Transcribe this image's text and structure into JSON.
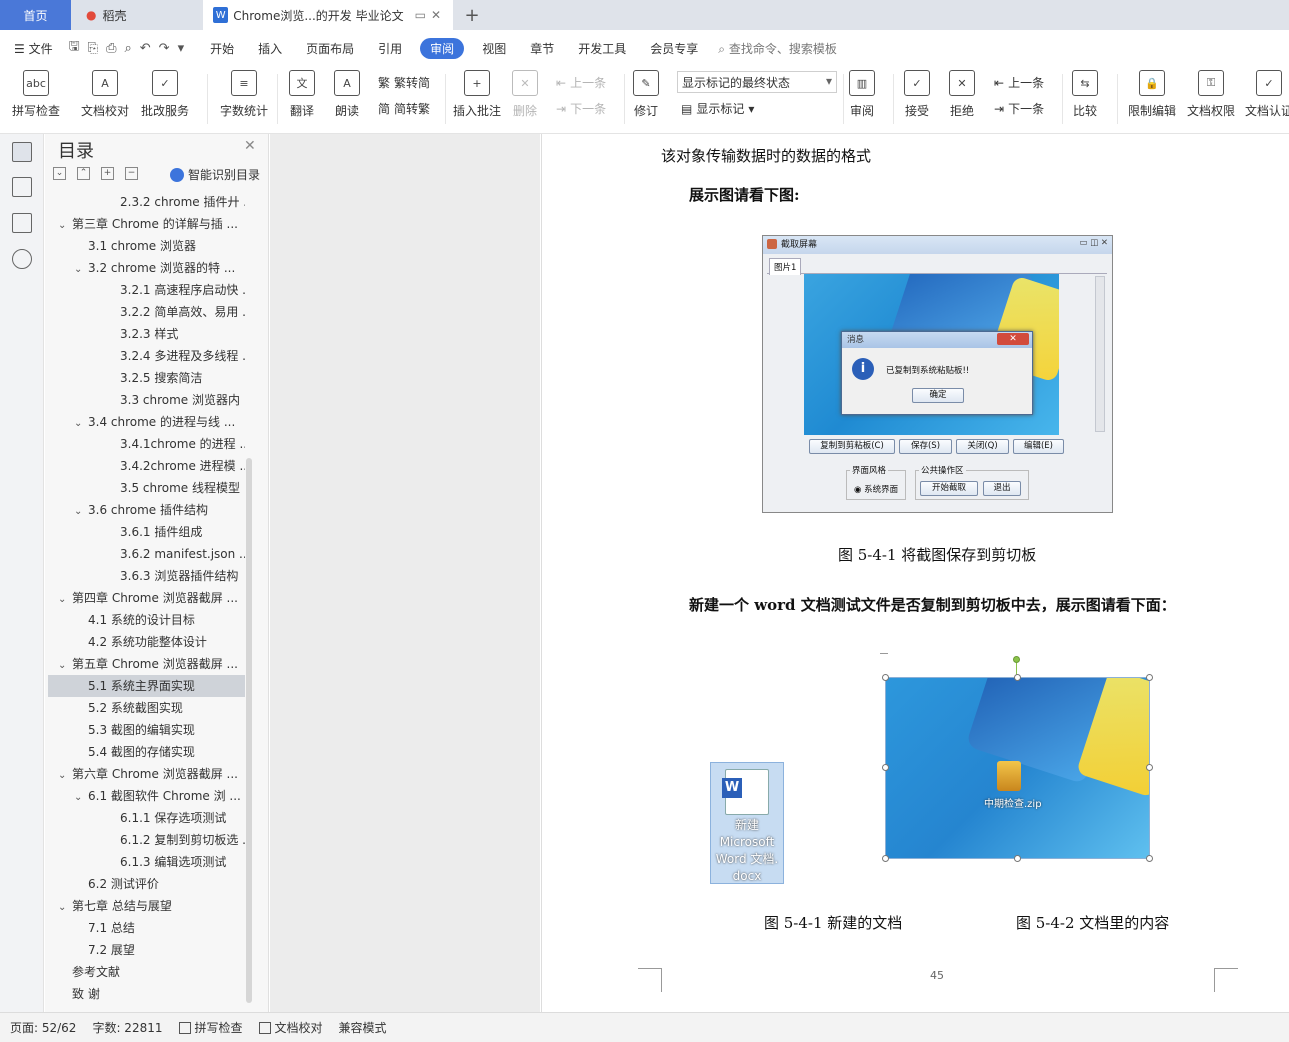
{
  "tabs": {
    "home": "首页",
    "daoke": "稻壳",
    "doc": "Chrome浏览...的开发 毕业论文"
  },
  "menu": {
    "file": "文件",
    "items": [
      "开始",
      "插入",
      "页面布局",
      "引用",
      "审阅",
      "视图",
      "章节",
      "开发工具",
      "会员专享"
    ],
    "active": "审阅",
    "search": "查找命令、搜索模板"
  },
  "ribbon": {
    "spell_check": "拼写检查",
    "doc_proof": "文档校对",
    "correction_service": "批改服务",
    "word_count": "字数统计",
    "translate": "翻译",
    "read_aloud": "朗读",
    "to_traditional": "繁转简",
    "to_simplified": "简转繁",
    "insert_comment": "插入批注",
    "delete": "删除",
    "prev_comment": "上一条",
    "next_comment": "下一条",
    "track_changes": "修订",
    "markup_state": "显示标记的最终状态",
    "show_markup": "显示标记",
    "review": "审阅",
    "accept": "接受",
    "reject": "拒绝",
    "prev_change": "上一条",
    "next_change": "下一条",
    "compare": "比较",
    "restrict_edit": "限制编辑",
    "doc_permission": "文档权限",
    "doc_cert": "文档认证"
  },
  "nav": {
    "title": "目录",
    "smart": "智能识别目录",
    "items": [
      {
        "label": "2.3.2 chrome 插件廾 ...",
        "level": 3,
        "arrow": ""
      },
      {
        "label": "第三章  Chrome 的详解与插 ...",
        "level": 1,
        "arrow": "v"
      },
      {
        "label": "3.1 chrome 浏览器",
        "level": 2,
        "arrow": ""
      },
      {
        "label": "3.2 chrome 浏览器的特 ...",
        "level": 2,
        "arrow": "v"
      },
      {
        "label": "3.2.1 高速程序启动快 ...",
        "level": 3,
        "arrow": ""
      },
      {
        "label": "3.2.2 简单高效、易用 ...",
        "level": 3,
        "arrow": ""
      },
      {
        "label": "3.2.3 样式",
        "level": 3,
        "arrow": ""
      },
      {
        "label": "3.2.4 多进程及多线程 ...",
        "level": 3,
        "arrow": ""
      },
      {
        "label": "3.2.5 搜索简洁",
        "level": 3,
        "arrow": ""
      },
      {
        "label": "3.3 chrome 浏览器内 ...",
        "level": 3,
        "arrow": ""
      },
      {
        "label": "3.4 chrome 的进程与线 ...",
        "level": 2,
        "arrow": "v"
      },
      {
        "label": "3.4.1chrome 的进程 ...",
        "level": 3,
        "arrow": ""
      },
      {
        "label": "3.4.2chrome 进程模 ...",
        "level": 3,
        "arrow": ""
      },
      {
        "label": "3.5 chrome 线程模型",
        "level": 3,
        "arrow": ""
      },
      {
        "label": "3.6 chrome 插件结构",
        "level": 2,
        "arrow": "v"
      },
      {
        "label": "3.6.1 插件组成",
        "level": 3,
        "arrow": ""
      },
      {
        "label": "3.6.2 manifest.json  ...",
        "level": 3,
        "arrow": ""
      },
      {
        "label": "3.6.3 浏览器插件结构",
        "level": 3,
        "arrow": ""
      },
      {
        "label": "第四章  Chrome 浏览器截屏 ...",
        "level": 1,
        "arrow": "v"
      },
      {
        "label": "4.1 系统的设计目标",
        "level": 2,
        "arrow": ""
      },
      {
        "label": "4.2 系统功能整体设计",
        "level": 2,
        "arrow": ""
      },
      {
        "label": "第五章  Chrome 浏览器截屏 ...",
        "level": 1,
        "arrow": "v"
      },
      {
        "label": "5.1 系统主界面实现",
        "level": 2,
        "arrow": "",
        "selected": true
      },
      {
        "label": "5.2 系统截图实现",
        "level": 2,
        "arrow": ""
      },
      {
        "label": "5.3 截图的编辑实现",
        "level": 2,
        "arrow": ""
      },
      {
        "label": "5.4 截图的存储实现",
        "level": 2,
        "arrow": ""
      },
      {
        "label": "第六章  Chrome 浏览器截屏 ...",
        "level": 1,
        "arrow": "v"
      },
      {
        "label": "6.1 截图软件 Chrome 浏 ...",
        "level": 2,
        "arrow": "v"
      },
      {
        "label": "6.1.1 保存选项测试",
        "level": 3,
        "arrow": ""
      },
      {
        "label": "6.1.2 复制到剪切板选 ...",
        "level": 3,
        "arrow": ""
      },
      {
        "label": "6.1.3 编辑选项测试",
        "level": 3,
        "arrow": ""
      },
      {
        "label": "6.2 测试评价",
        "level": 2,
        "arrow": ""
      },
      {
        "label": "第七章  总结与展望",
        "level": 1,
        "arrow": "v"
      },
      {
        "label": "7.1 总结",
        "level": 2,
        "arrow": ""
      },
      {
        "label": "7.2 展望",
        "level": 2,
        "arrow": ""
      },
      {
        "label": "参考文献",
        "level": 1,
        "arrow": ""
      },
      {
        "label": "致    谢",
        "level": 1,
        "arrow": ""
      }
    ]
  },
  "doc": {
    "line1": "该对象传输数据时的数据的格式",
    "line2": "展示图请看下图:",
    "caption1": "图 5-4-1 将截图保存到剪切板",
    "line3": "新建一个 word 文档测试文件是否复制到剪切板中去，展示图请看下面：",
    "caption_left": "图 5-4-1 新建的文档",
    "caption_right": "图 5-4-2 文档里的内容",
    "page_number": "45"
  },
  "shot1": {
    "title": "截取屏幕",
    "tab": "图片1",
    "dialog_title": "消息",
    "dialog_msg": "已复制到系统粘贴板!!",
    "dialog_ok": "确定",
    "btn_copy": "复制到剪粘板(C)",
    "btn_save": "保存(S)",
    "btn_close": "关闭(Q)",
    "btn_edit": "编辑(E)",
    "style_label": "界面风格",
    "style_option": "系统界面",
    "ops_label": "公共操作区",
    "btn_start": "开始截取",
    "btn_exit": "退出"
  },
  "shot2": {
    "file_label": "中期检查.zip"
  },
  "word_icon": {
    "label_line1": "新建",
    "label_line2": "Microsoft",
    "label_line3": "Word 文档.",
    "label_line4": "docx"
  },
  "status": {
    "page": "页面: 52/62",
    "words": "字数: 22811",
    "spell": "拼写检查",
    "proof": "文档校对",
    "compat": "兼容模式"
  }
}
